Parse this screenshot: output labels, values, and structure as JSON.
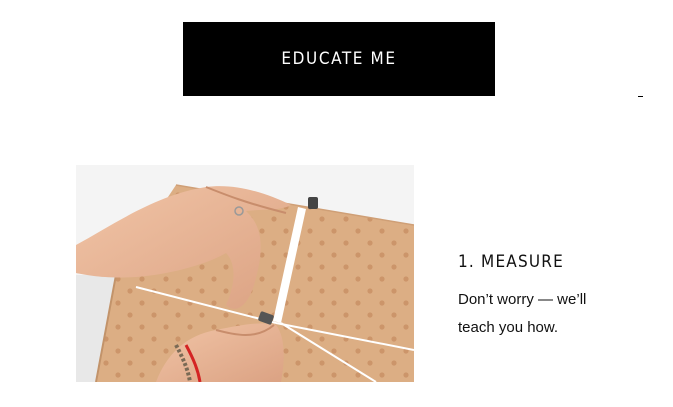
{
  "cta": {
    "label": "EDUCATE ME"
  },
  "step": {
    "title": "1. MEASURE",
    "body": "Don’t worry — we’ll teach you how."
  },
  "colors": {
    "cta_background": "#000000",
    "cta_text": "#ffffff",
    "box_kraft": "#dcae84",
    "tape_red": "#d42424"
  },
  "image": {
    "icon": "measuring-box-photo"
  }
}
